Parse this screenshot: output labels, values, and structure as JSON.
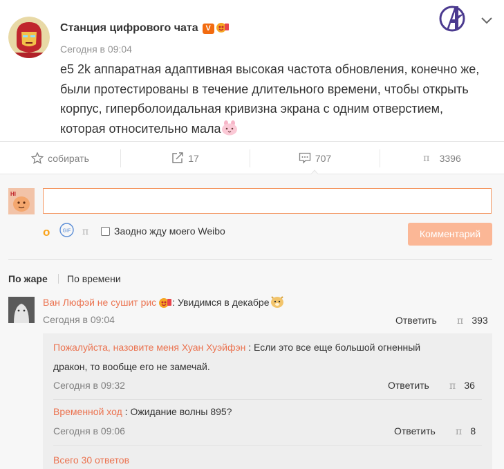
{
  "post": {
    "author": "Станция цифрового чата",
    "badge_v": "V",
    "time": "Сегодня в 09:04",
    "text": "e5 2k аппаратная адаптивная высокая частота обновления, конечно же, были протестированы в течение длительного времени, чтобы открыть корпус, гиперболоидальная кривизна экрана с одним отверстием, которая относительно мала"
  },
  "actions": {
    "collect": "собирать",
    "repost_count": "17",
    "comment_count": "707",
    "like_count": "3396"
  },
  "reply_form": {
    "input_value": "",
    "emoji_glyph": "o",
    "gif_label": "GIF",
    "pic_glyph": "п",
    "also_repost": "Заодно жду моего Weibo",
    "submit": "Комментарий"
  },
  "sort": {
    "by_hot": "По жаре",
    "by_time": "По времени"
  },
  "comment": {
    "user": "Ван Люфэй не сушит рис",
    "text": ": Увидимся в декабре",
    "time": "Сегодня в 09:04",
    "reply": "Ответить",
    "like_glyph": "п",
    "likes": "393"
  },
  "sub_replies": [
    {
      "user": "Пожалуйста, назовите меня Хуан Хуэйфэн",
      "text_line1": " : Если это все еще большой огненный",
      "text_line2": "дракон, то вообще его не замечай.",
      "time": "Сегодня в 09:32",
      "reply": "Ответить",
      "likes": "36"
    },
    {
      "user": "Временной ход",
      "text_line1": " : Ожидание волны 895?",
      "time": "Сегодня в 09:06",
      "reply": "Ответить",
      "likes": "8"
    }
  ],
  "more_replies": "Всего 30 ответов",
  "colors": {
    "accent": "#eb7350",
    "input_border": "#f49863",
    "submit_bg": "#fbb796",
    "vip": "#f26b0f"
  }
}
